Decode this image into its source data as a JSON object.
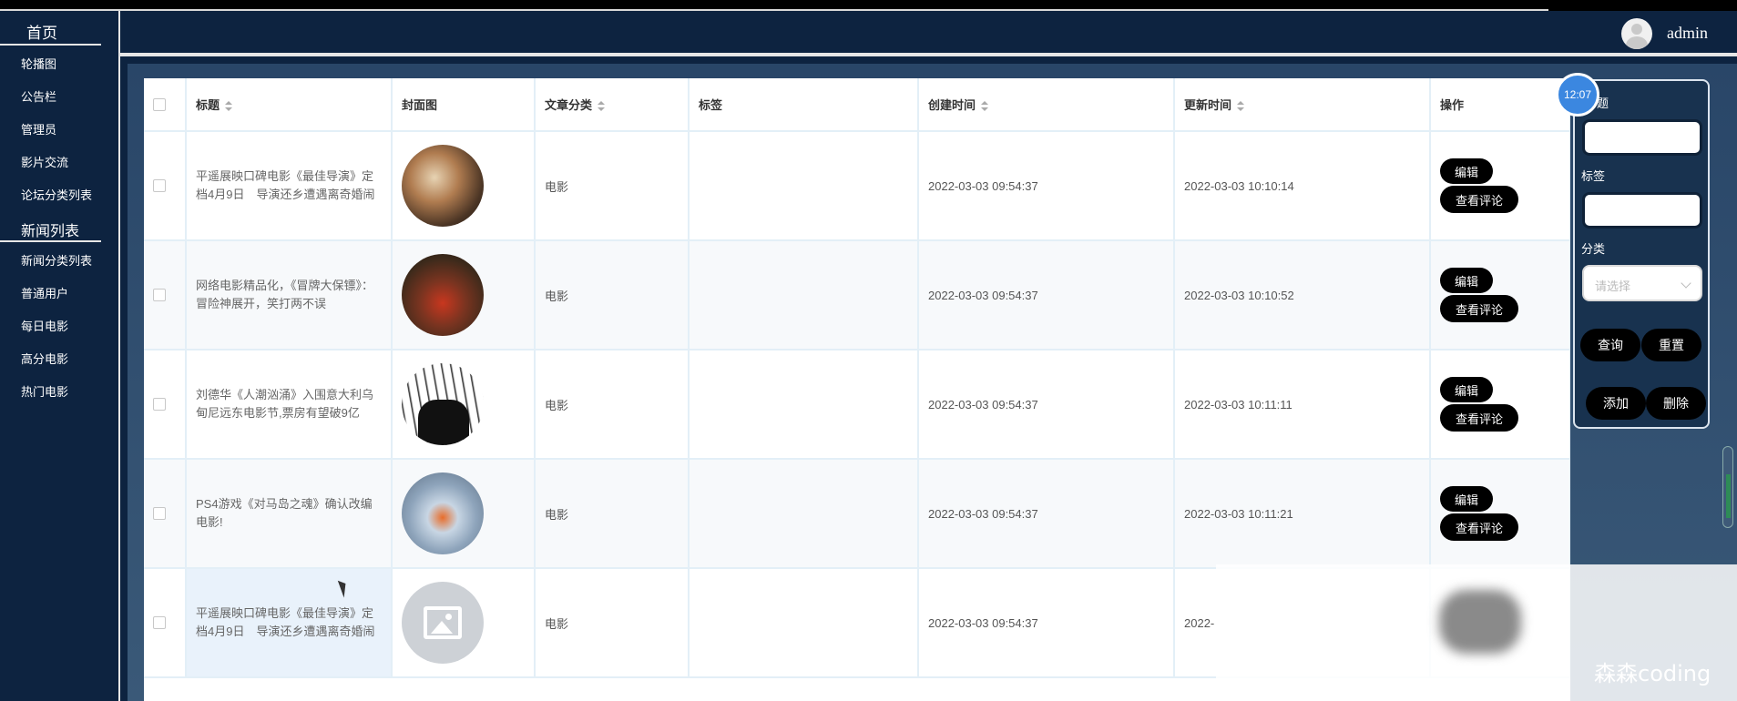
{
  "app": {
    "user": "admin"
  },
  "sidebar": {
    "home": "首页",
    "items": [
      {
        "label": "轮播图"
      },
      {
        "label": "公告栏"
      },
      {
        "label": "管理员"
      },
      {
        "label": "影片交流"
      },
      {
        "label": "论坛分类列表"
      }
    ],
    "group": "新闻列表",
    "items2": [
      {
        "label": "新闻分类列表"
      },
      {
        "label": "普通用户"
      },
      {
        "label": "每日电影"
      },
      {
        "label": "高分电影"
      },
      {
        "label": "热门电影"
      }
    ]
  },
  "table": {
    "headers": {
      "title": "标题",
      "cover": "封面图",
      "category": "文章分类",
      "tags": "标签",
      "created": "创建时间",
      "updated": "更新时间",
      "actions": "操作"
    },
    "rows": [
      {
        "title": "平遥展映口碑电影《最佳导演》定档4月9日　导演还乡遭遇离奇婚闹",
        "category": "电影",
        "tags": "",
        "created": "2022-03-03 09:54:37",
        "updated": "2022-03-03 10:10:14"
      },
      {
        "title": "网络电影精品化，《冒牌大保镖》：冒险神展开，笑打两不误",
        "category": "电影",
        "tags": "",
        "created": "2022-03-03 09:54:37",
        "updated": "2022-03-03 10:10:52"
      },
      {
        "title": "刘德华《人潮汹涌》入围意大利乌甸尼远东电影节,票房有望破9亿",
        "category": "电影",
        "tags": "",
        "created": "2022-03-03 09:54:37",
        "updated": "2022-03-03 10:11:11"
      },
      {
        "title": "PS4游戏《对马岛之魂》确认改编电影!",
        "category": "电影",
        "tags": "",
        "created": "2022-03-03 09:54:37",
        "updated": "2022-03-03 10:11:21"
      },
      {
        "title": "平遥展映口碑电影《最佳导演》定档4月9日　导演还乡遭遇离奇婚闹",
        "category": "电影",
        "tags": "",
        "created": "2022-03-03 09:54:37",
        "updated": "2022-"
      }
    ],
    "edit_label": "编辑",
    "view_comments_label": "查看评论"
  },
  "filter": {
    "title_label": "题",
    "tags_label": "标签",
    "category_label": "分类",
    "category_placeholder": "请选择",
    "search_button": "查询",
    "reset_button": "重置",
    "add_button": "添加",
    "delete_button": "删除"
  },
  "overlay": {
    "clock": "12:07",
    "watermark": "森森coding"
  }
}
